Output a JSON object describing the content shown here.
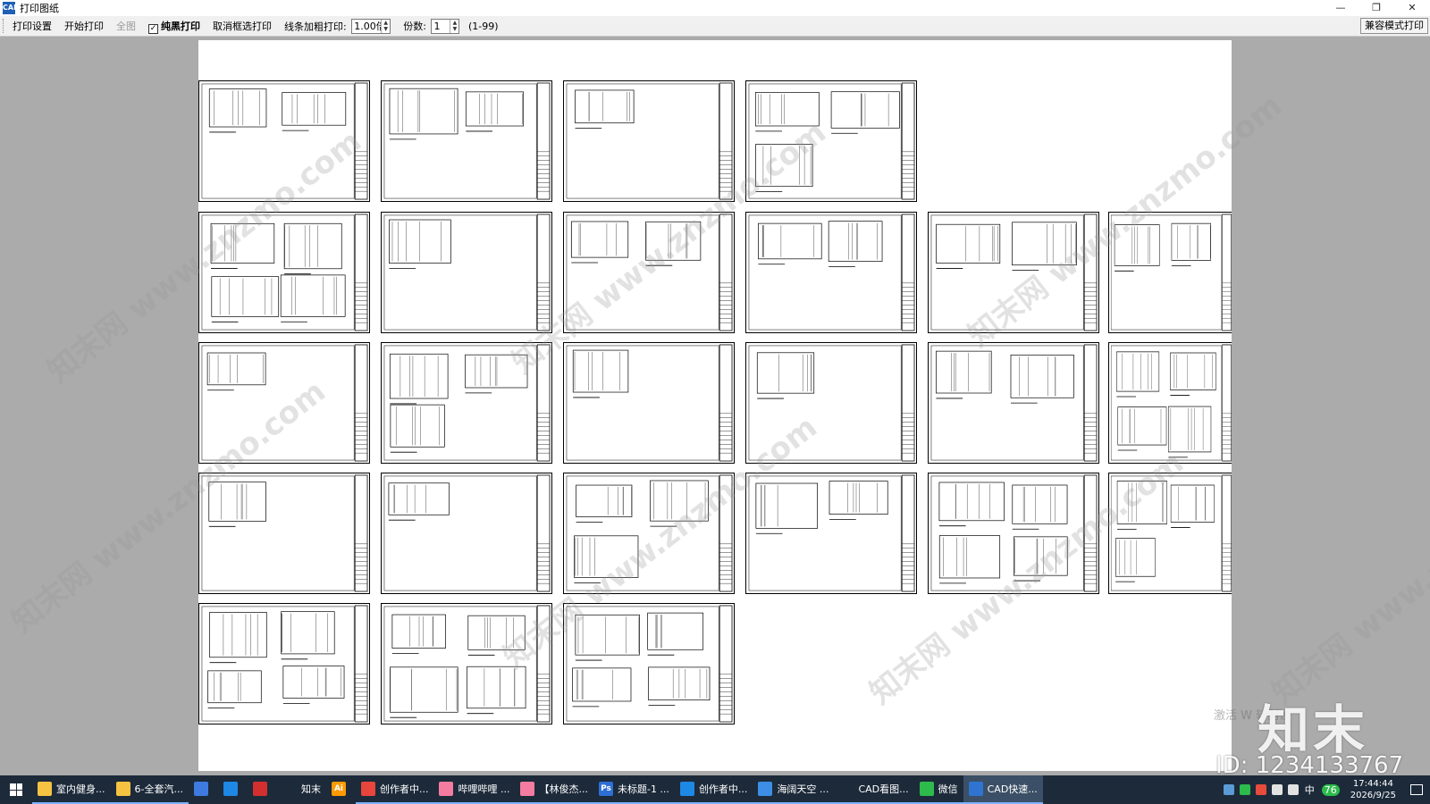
{
  "window": {
    "title": "打印图纸",
    "app_icon_label": "CAD",
    "controls": {
      "minimize": "—",
      "restore": "❐",
      "close": "✕"
    }
  },
  "toolbar": {
    "print_settings": "打印设置",
    "start_print": "开始打印",
    "full_view": "全图",
    "pure_black": "纯黑打印",
    "pure_black_checked": true,
    "cancel_selection": "取消框选打印",
    "line_bold_label": "线条加粗打印:",
    "line_bold_value": "1.00倍",
    "copies_label": "份数:",
    "copies_value": "1",
    "copies_range": "(1-99)",
    "compat_print": "兼容模式打印"
  },
  "canvas": {
    "watermark": "知末网 www.znzmo.com",
    "brand": "知末",
    "activate_text": "激活 W\n转到设",
    "id_text": "ID: 1234133767"
  },
  "taskbar": {
    "apps": [
      {
        "label": "室内健身...",
        "color": "#f5c242",
        "state": "running"
      },
      {
        "label": "6-全套汽...",
        "color": "#f5c242",
        "state": "running"
      },
      {
        "label": "",
        "color": "#3d7be0",
        "state": "normal",
        "icon": "calculator-icon"
      },
      {
        "label": "",
        "color": "#1e88e5",
        "state": "normal",
        "icon": "browser-icon"
      },
      {
        "label": "",
        "color": "#d32f2f",
        "state": "normal",
        "icon": "acrobat-icon"
      },
      {
        "label": "知末",
        "color": "#1c2a3a",
        "state": "normal"
      },
      {
        "label": "",
        "color": "#ff9a00",
        "state": "normal",
        "icon": "illustrator-icon",
        "glyph": "Ai"
      },
      {
        "label": "创作者中...",
        "color": "#e8453c",
        "state": "running"
      },
      {
        "label": "哔哩哔哩 ...",
        "color": "#f47ca0",
        "state": "running"
      },
      {
        "label": "【林俊杰...",
        "color": "#f47ca0",
        "state": "running"
      },
      {
        "label": "未标题-1 ...",
        "color": "#2d6fd6",
        "state": "running",
        "glyph": "Ps"
      },
      {
        "label": "创作者中...",
        "color": "#1e88e5",
        "state": "running"
      },
      {
        "label": "海阔天空 ...",
        "color": "#3c8ee6",
        "state": "running"
      },
      {
        "label": "CAD看图...",
        "color": "#1c2a3a",
        "state": "running"
      },
      {
        "label": "微信",
        "color": "#2dbb4c",
        "state": "running"
      },
      {
        "label": "CAD快速...",
        "color": "#2f74d0",
        "state": "active"
      }
    ],
    "ime": "中",
    "badge": "76",
    "time": "17:44:44",
    "date": "2026/9/25"
  }
}
